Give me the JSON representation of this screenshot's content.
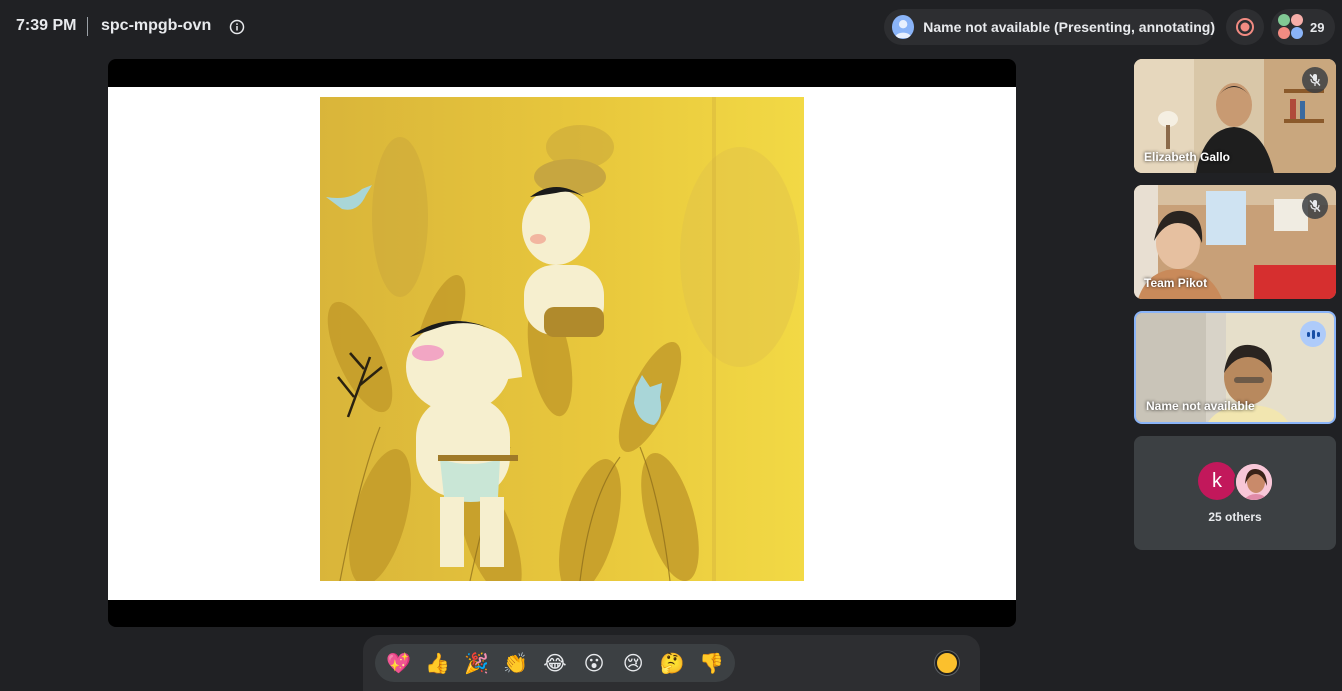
{
  "header": {
    "time": "7:39 PM",
    "meeting_code": "spc-mpgb-ovn",
    "presenter_label": "Name not available (Presenting, annotating)",
    "participant_count": "29"
  },
  "participants": [
    {
      "name": "Elizabeth Gallo",
      "muted": true
    },
    {
      "name": "Team Pikot",
      "muted": true
    },
    {
      "name": "Name not available",
      "speaking": true
    }
  ],
  "others": {
    "initial": "k",
    "label": "25 others"
  },
  "reactions": {
    "items": [
      "💖",
      "👍",
      "🎉",
      "👏",
      "😂",
      "😮",
      "😢",
      "🤔",
      "👎"
    ]
  },
  "colors": {
    "background": "#202124",
    "accent": "#8ab4f8",
    "record": "#f28b82",
    "avatar_k": "#c2185b",
    "skin_tone": "#fbc02d"
  }
}
